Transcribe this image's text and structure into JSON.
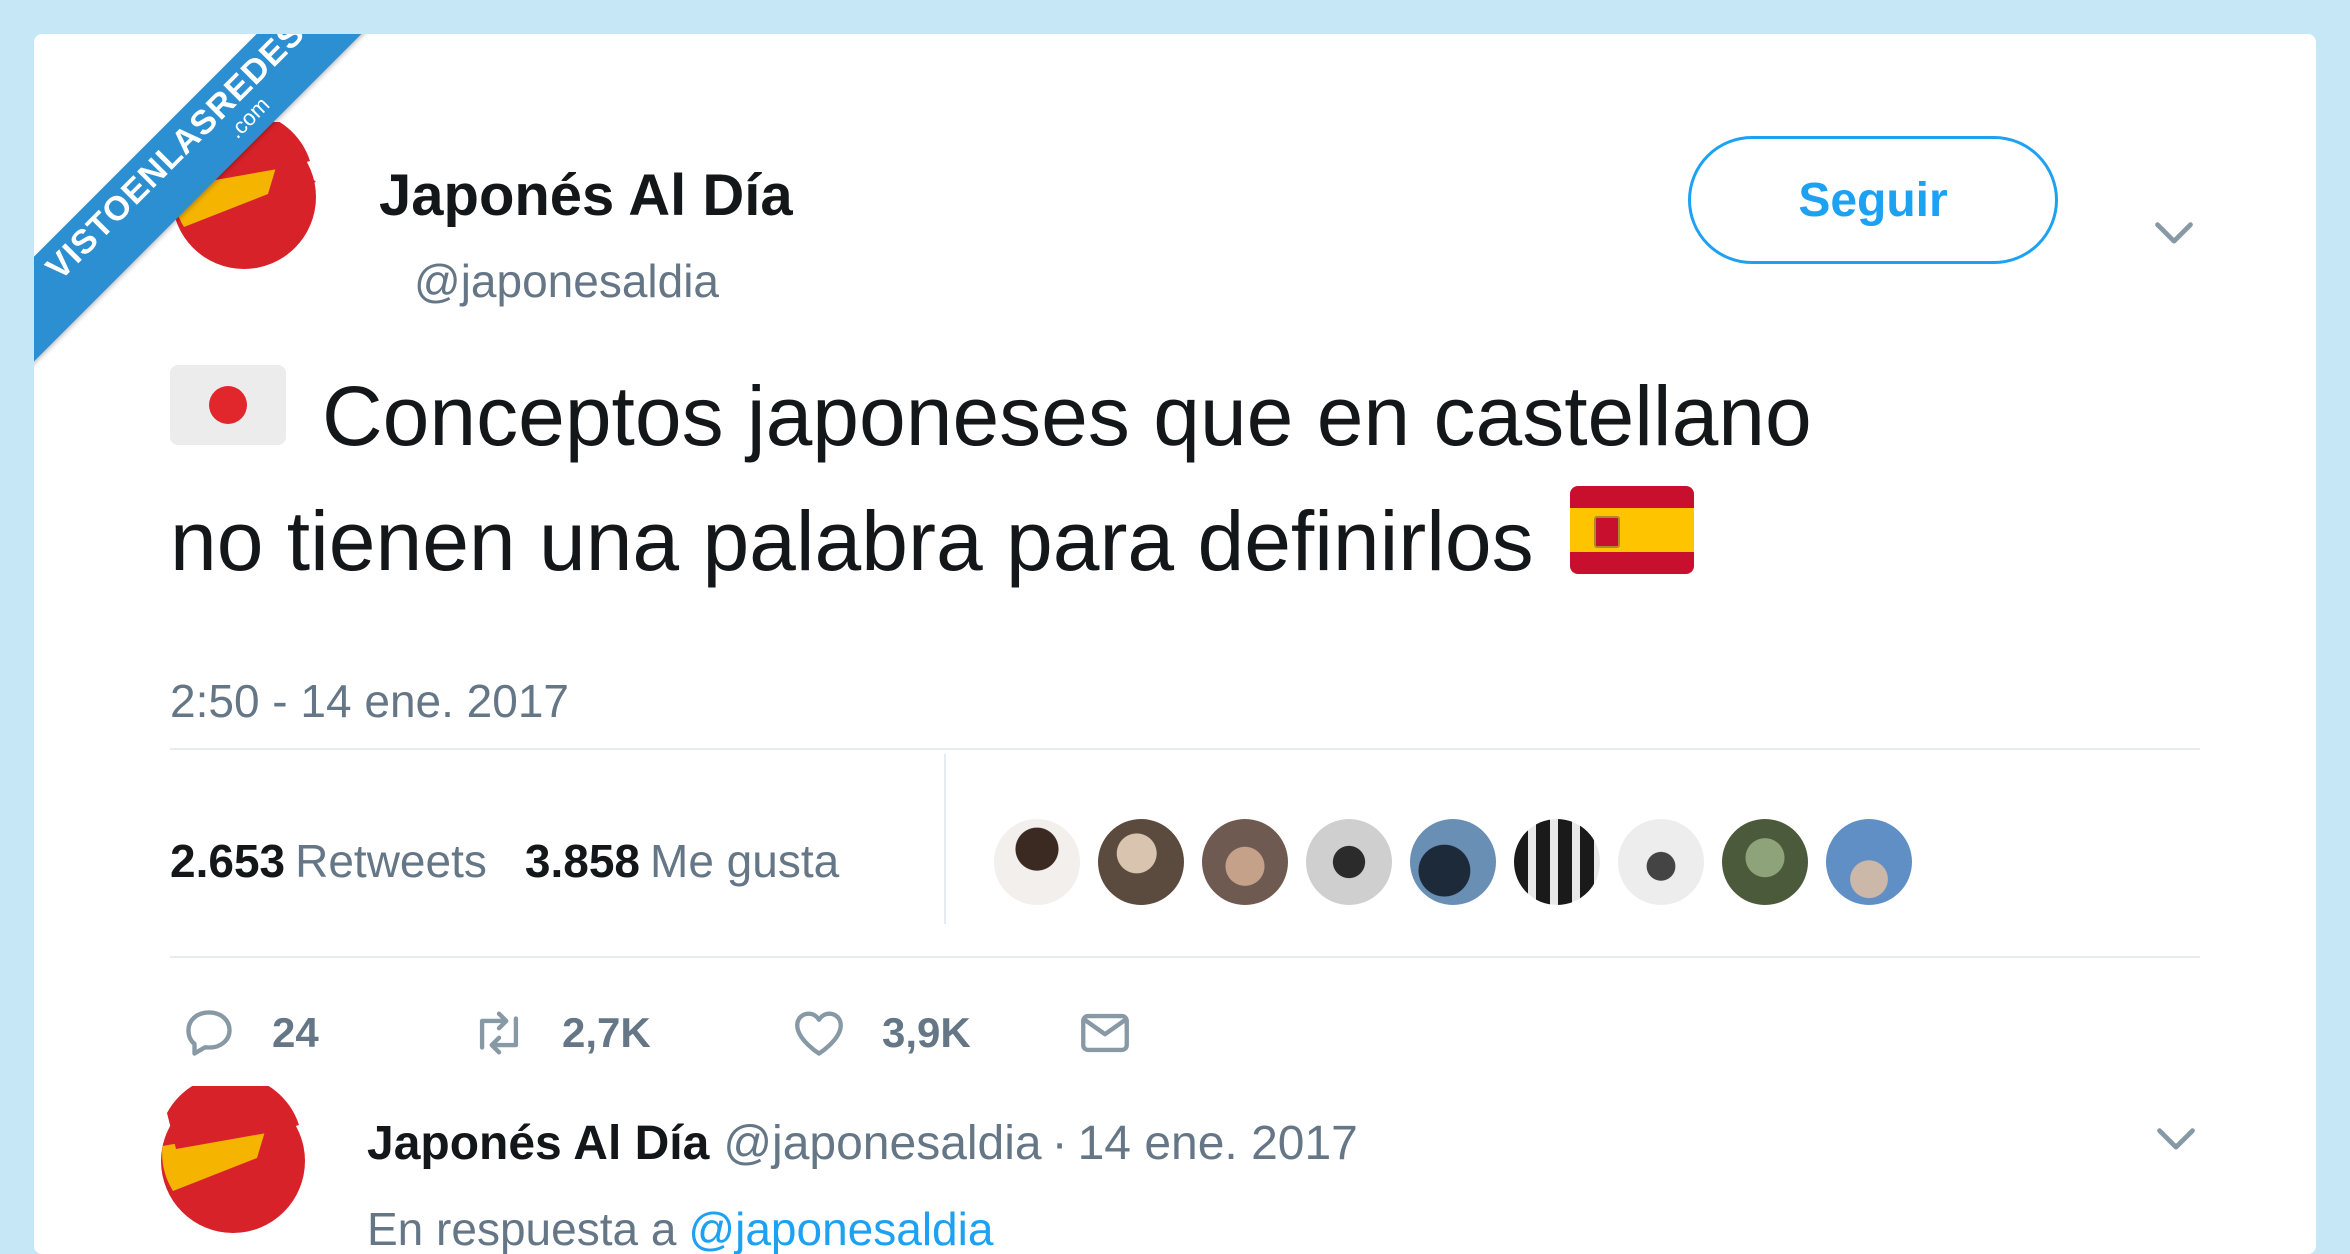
{
  "watermark": {
    "line1": "VISTOENLASREDES",
    "line2": ".com"
  },
  "tweet": {
    "display_name": "Japonés Al Día",
    "handle": "@japonesaldia",
    "follow_label": "Seguir",
    "text_line1": "Conceptos japoneses que en castellano",
    "text_line2": "no tienen una palabra para definirlos",
    "timestamp": "2:50 - 14 ene. 2017",
    "stats": {
      "retweets_count": "2.653",
      "retweets_label": "Retweets",
      "likes_count": "3.858",
      "likes_label": "Me gusta"
    },
    "actions": {
      "replies": "24",
      "retweets": "2,7K",
      "likes": "3,9K"
    }
  },
  "reply": {
    "display_name": "Japonés Al Día",
    "handle": "@japonesaldia",
    "separator": "·",
    "date": "14 ene. 2017",
    "in_reply_prefix": "En respuesta a",
    "in_reply_mention": "@japonesaldia"
  },
  "colors": {
    "background": "#c6e7f6",
    "accent": "#1da1f2",
    "secondary_text": "#657786",
    "ribbon": "#2b8fd1",
    "logo_red": "#d8222a",
    "logo_yellow": "#f4b400"
  },
  "icons": [
    "chevron-down-icon",
    "reply-icon",
    "retweet-icon",
    "heart-icon",
    "mail-icon",
    "japan-flag-icon",
    "spain-flag-icon"
  ]
}
